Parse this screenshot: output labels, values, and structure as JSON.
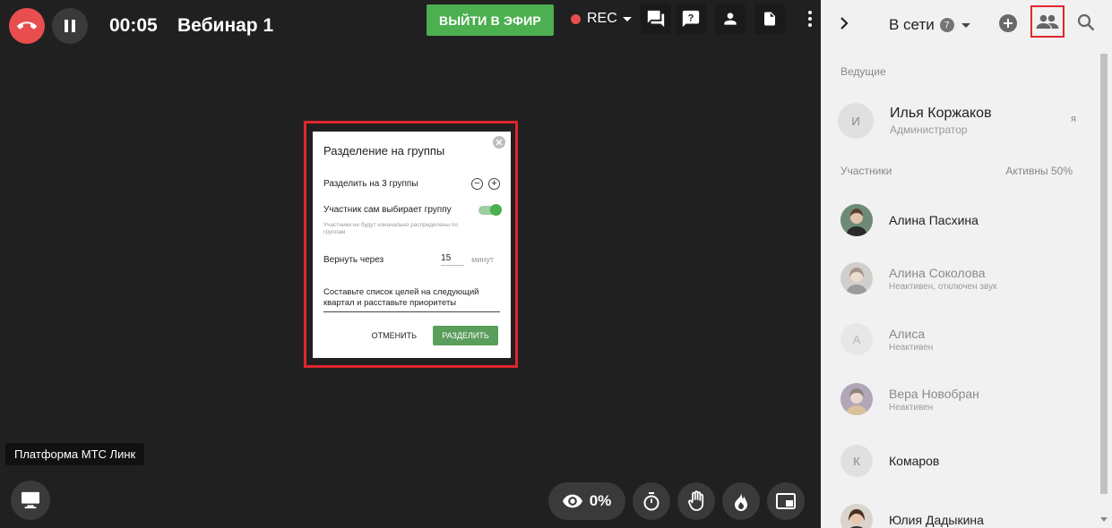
{
  "toolbar": {
    "timer": "00:05",
    "title": "Вебинар 1",
    "go_live_label": "ВЫЙТИ В ЭФИР",
    "rec_label": "REC"
  },
  "modal": {
    "title": "Разделение на группы",
    "split_label": "Разделить на 3 группы",
    "self_choose_label": "Участник сам выбирает группу",
    "self_choose_hint": "Участники не будут изначально распределены по группам",
    "return_label": "Вернуть через",
    "return_value": "15",
    "return_unit": "минут",
    "task_text": "Составьте список целей на следующий квартал и расставьте приоритеты",
    "cancel_label": "ОТМЕНИТЬ",
    "split_button_label": "РАЗДЕЛИТЬ"
  },
  "platform_tooltip": "Платформа МТС Линк",
  "bottom_bar": {
    "views_percent": "0%"
  },
  "panel": {
    "online_label": "В сети",
    "online_count": "7",
    "hosts_label": "Ведущие",
    "participants_label": "Участники",
    "active_label": "Активны 50%",
    "hosts": [
      {
        "initial": "И",
        "name": "Илья Коржаков",
        "role": "Администратор",
        "tag": "я"
      }
    ],
    "participants": [
      {
        "initial": "",
        "name": "Алина Пасхина",
        "status": ""
      },
      {
        "initial": "",
        "name": "Алина Соколова",
        "status": "Неактивен, отключен звук"
      },
      {
        "initial": "А",
        "name": "Алиса",
        "status": "Неактивен"
      },
      {
        "initial": "",
        "name": "Вера Новобран",
        "status": "Неактивен"
      },
      {
        "initial": "К",
        "name": "Комаров",
        "status": ""
      },
      {
        "initial": "",
        "name": "Юлия Дадыкина",
        "status": ""
      }
    ]
  },
  "colors": {
    "accent_green": "#4caf50",
    "danger_red": "#e84e4e",
    "highlight_red": "#e0262b"
  }
}
